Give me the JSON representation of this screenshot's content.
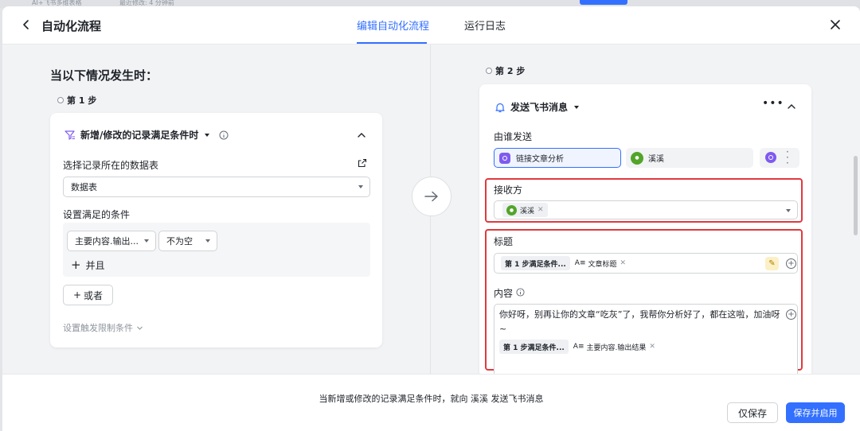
{
  "backdrop": {
    "frag1": "AI+飞书多维表格",
    "frag2": "最近修改: 4 分钟前"
  },
  "header": {
    "title": "自动化流程",
    "tabs": [
      {
        "label": "编辑自动化流程",
        "active": true
      },
      {
        "label": "运行日志",
        "active": false
      }
    ]
  },
  "left": {
    "section_title": "当以下情况发生时：",
    "step_label": "第 1 步",
    "trigger": {
      "title": "新增/修改的记录满足条件时",
      "table_label": "选择记录所在的数据表",
      "table_value": "数据表",
      "conditions_label": "设置满足的条件",
      "condition_field": "主要内容.输出...",
      "condition_op": "不为空",
      "and_label": "并且",
      "or_button": "或者",
      "limit_link": "设置触发限制条件"
    }
  },
  "right": {
    "step_label": "第 2 步",
    "action": {
      "title": "发送飞书消息",
      "sender_label": "由谁发送",
      "sender_app": "链接文章分析",
      "sender_user": "溪溪",
      "receiver_label": "接收方",
      "receiver_tag": "溪溪",
      "heading_label": "标题",
      "heading_ref_tag": "第 1 步满足条件...",
      "heading_field_tag": "文章标题",
      "content_label": "内容",
      "content_text": "你好呀，别再让你的文章“吃灰”了，我帮你分析好了，都在这啦，加油呀~",
      "content_ref_tag": "第 1 步满足条件...",
      "content_field_tag": "主要内容.输出结果"
    }
  },
  "footer": {
    "summary": "当新增或修改的记录满足条件时，就向 溪溪 发送飞书消息",
    "save_label": "仅保存",
    "save_enable_label": "保存并启用"
  },
  "colors": {
    "accent": "#3370ff",
    "highlight_frame": "#e0393e",
    "app_icon": "#7f5af0",
    "avatar": "#52a529"
  }
}
